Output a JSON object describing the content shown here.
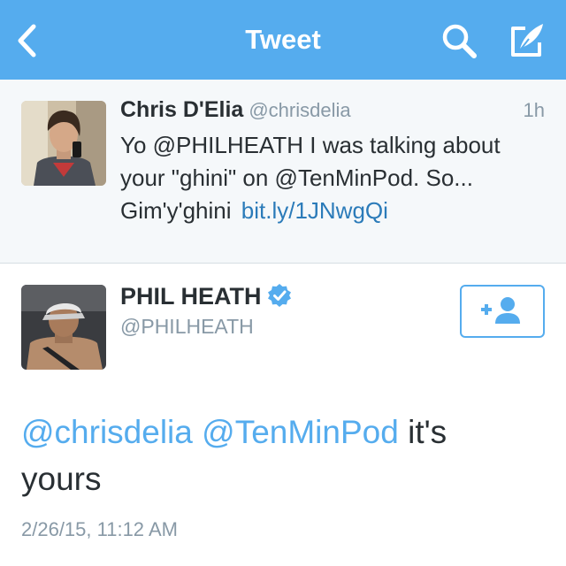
{
  "nav": {
    "title": "Tweet",
    "back_icon": "chevron-left-icon",
    "search_icon": "search-icon",
    "compose_icon": "compose-icon"
  },
  "context_tweet": {
    "name": "Chris D'Elia",
    "handle": "@chrisdelia",
    "time": "1h",
    "text_line1": "Yo @PHILHEATH I was talking about",
    "text_line2": "your \"ghini\" on @TenMinPod. So...",
    "text_line3": "Gim'y'ghini",
    "link": "bit.ly/1JNwgQi"
  },
  "main_tweet": {
    "name": "PHIL HEATH",
    "verified": true,
    "handle": "@PHILHEATH",
    "mention1": "@chrisdelia",
    "mention2": "@TenMinPod",
    "text_rest_line1": "it's",
    "text_line2": "yours",
    "timestamp": "2/26/15, 11:12 AM",
    "follow_icon": "add-user-icon"
  },
  "colors": {
    "nav_bg": "#55acee",
    "link": "#2b7bb9",
    "mention": "#55acee",
    "secondary_text": "#8899a6",
    "context_bg": "#f5f8fa"
  }
}
